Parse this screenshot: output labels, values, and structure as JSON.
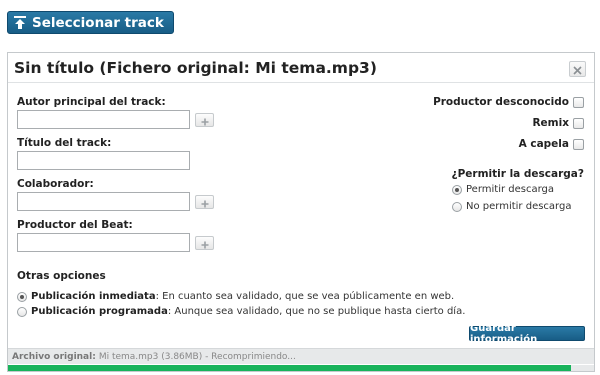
{
  "top_button": {
    "label": "Seleccionar track",
    "icon": "upload-icon"
  },
  "dialog": {
    "title": "Sin título (Fichero original: Mi tema.mp3)",
    "close_icon": "close-icon"
  },
  "fields": {
    "autor": {
      "label": "Autor principal del track:",
      "value": ""
    },
    "titulo": {
      "label": "Título del track:",
      "value": ""
    },
    "colaborador": {
      "label": "Colaborador:",
      "value": ""
    },
    "productor": {
      "label": "Productor del Beat:",
      "value": ""
    }
  },
  "checkboxes": {
    "productor_desconocido": {
      "label": "Productor desconocido",
      "checked": false
    },
    "remix": {
      "label": "Remix",
      "checked": false
    },
    "a_capela": {
      "label": "A capela",
      "checked": false
    }
  },
  "download": {
    "title": "¿Permitir la descarga?",
    "options": [
      {
        "label": "Permitir descarga",
        "checked": true
      },
      {
        "label": "No permitir descarga",
        "checked": false
      }
    ]
  },
  "otras_opciones": {
    "title": "Otras opciones",
    "options": [
      {
        "label": "Publicación inmediata",
        "desc": ": En cuanto sea validado, que se vea públicamente en web.",
        "checked": true
      },
      {
        "label": "Publicación programada",
        "desc": ": Aunque sea validado, que no se publique hasta cierto día.",
        "checked": false
      }
    ]
  },
  "save_button": {
    "label": "Guardar información"
  },
  "footer": {
    "label": "Archivo original:",
    "text": "Mi tema.mp3 (3.86MB) - Recomprimiendo..."
  },
  "progress": {
    "fraction": 0.96,
    "color": "#18b35b"
  }
}
